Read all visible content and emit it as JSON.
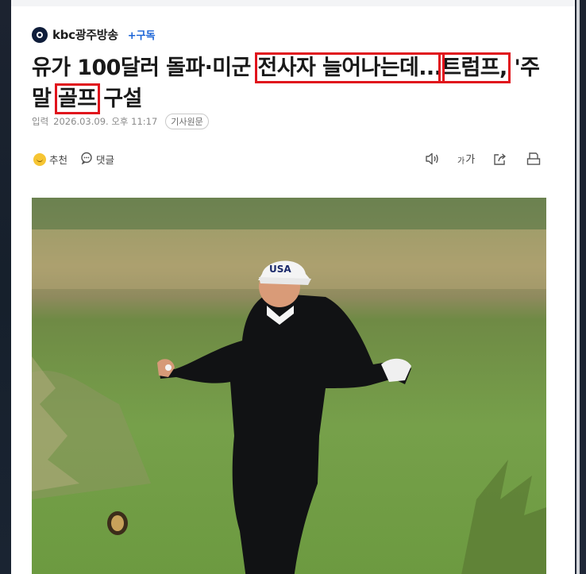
{
  "press": {
    "name": "kbc광주방송",
    "subscribe": "+구독"
  },
  "headline": {
    "part1": "유가 100달러 돌파·미군 ",
    "hl1": "전사자 늘어나는데...",
    "hl2": "트럼프,",
    "part2": " '주말 ",
    "hl3": "골프",
    "part3": " 구설"
  },
  "meta": {
    "input_label": "입력",
    "datetime": "2026.03.09. 오후 11:17",
    "source_button": "기사원문"
  },
  "actions": {
    "recommend": "추천",
    "comment": "댓글",
    "font_size_small": "가",
    "font_size_large": "가"
  },
  "photo": {
    "cap_text": "USA"
  },
  "colors": {
    "highlight": "#e0141c",
    "subscribe": "#1a63d6",
    "press_logo": "#0f1d3a"
  }
}
